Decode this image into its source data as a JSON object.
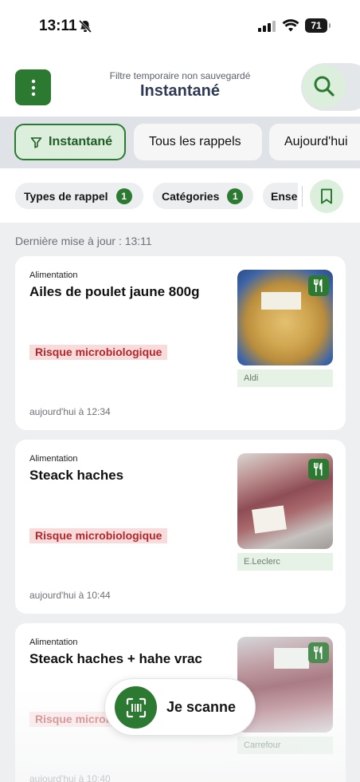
{
  "status_bar": {
    "time": "13:11",
    "battery": "71"
  },
  "header": {
    "subtitle": "Filtre temporaire non sauvegardé",
    "title": "Instantané"
  },
  "tabs": [
    {
      "label": "Instantané",
      "active": true
    },
    {
      "label": "Tous les rappels",
      "active": false
    },
    {
      "label": "Aujourd'hui",
      "active": false
    }
  ],
  "chips": [
    {
      "label": "Types de rappel",
      "badge": "1"
    },
    {
      "label": "Catégories",
      "badge": "1"
    },
    {
      "label": "Ense"
    }
  ],
  "last_update": "Dernière mise à jour : 13:11",
  "cards": [
    {
      "category": "Alimentation",
      "title": "Ailes de poulet jaune 800g",
      "risk": "Risque microbiologique",
      "store": "Aldi",
      "date": "aujourd'hui à 12:34",
      "icon": "fork-knife-icon"
    },
    {
      "category": "Alimentation",
      "title": "Steack haches",
      "risk": "Risque microbiologique",
      "store": "E.Leclerc",
      "date": "aujourd'hui à 10:44",
      "icon": "fork-knife-icon"
    },
    {
      "category": "Alimentation",
      "title": "Steack haches + hahe vrac",
      "risk": "Risque microbiologique",
      "store": "Carrefour",
      "date": "aujourd'hui à 10:40",
      "icon": "fork-knife-icon"
    }
  ],
  "scan_button": {
    "label": "Je scanne"
  },
  "colors": {
    "brand_green": "#2c7a32",
    "light_green": "#dcefdc",
    "risk_red": "#b4262b",
    "risk_bg": "#f8dcdc"
  }
}
